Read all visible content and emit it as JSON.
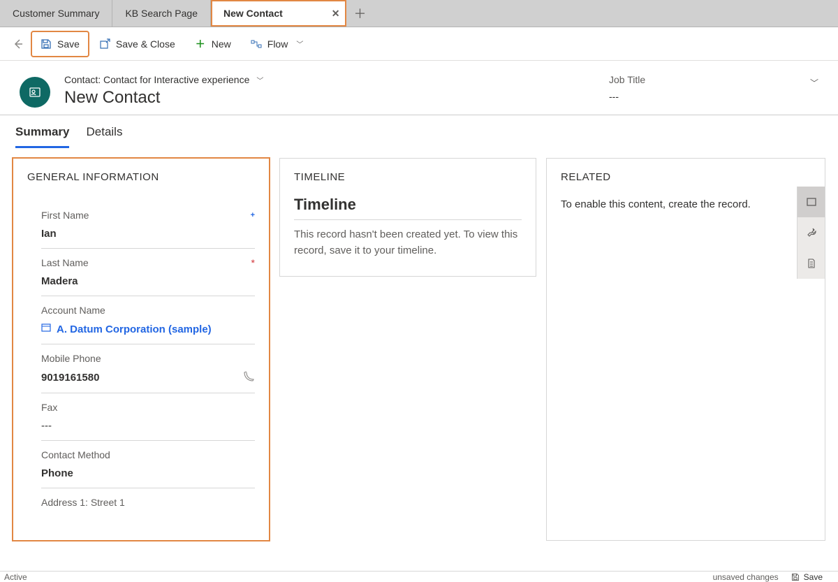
{
  "tabs": {
    "items": [
      {
        "label": "Customer Summary",
        "active": false
      },
      {
        "label": "KB Search Page",
        "active": false
      },
      {
        "label": "New Contact",
        "active": true
      }
    ]
  },
  "commands": {
    "save": "Save",
    "save_close": "Save & Close",
    "new": "New",
    "flow": "Flow"
  },
  "header": {
    "form_name_prefix": "Contact: Contact for Interactive experience",
    "record_title": "New Contact",
    "job_title_label": "Job Title",
    "job_title_value": "---"
  },
  "navtabs": {
    "summary": "Summary",
    "details": "Details"
  },
  "general": {
    "title": "GENERAL INFORMATION",
    "first_name": {
      "label": "First Name",
      "value": "Ian"
    },
    "last_name": {
      "label": "Last Name",
      "value": "Madera"
    },
    "account_name": {
      "label": "Account Name",
      "value": "A. Datum Corporation (sample)"
    },
    "mobile_phone": {
      "label": "Mobile Phone",
      "value": "9019161580"
    },
    "fax": {
      "label": "Fax",
      "value": "---"
    },
    "contact_method": {
      "label": "Contact Method",
      "value": "Phone"
    },
    "address1_street1": {
      "label": "Address 1: Street 1"
    }
  },
  "timeline": {
    "section": "TIMELINE",
    "title": "Timeline",
    "text": "This record hasn't been created yet.  To view this record, save it to your timeline."
  },
  "related": {
    "section": "RELATED",
    "text": "To enable this content, create the record."
  },
  "footer": {
    "status": "Active",
    "unsaved": "unsaved changes",
    "save": "Save"
  }
}
